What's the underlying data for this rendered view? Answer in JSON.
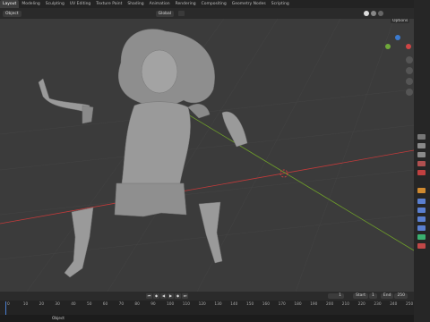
{
  "workspace_tabs": [
    "Layout",
    "Modeling",
    "Sculpting",
    "UV Editing",
    "Texture Paint",
    "Shading",
    "Animation",
    "Rendering",
    "Compositing",
    "Geometry Nodes",
    "Scripting"
  ],
  "header": {
    "object_mode": "Object",
    "transform": "Global",
    "options": "Options"
  },
  "timeline": {
    "current_frame": "1",
    "start_label": "Start",
    "start": "1",
    "end_label": "End",
    "end": "250",
    "ruler": [
      "0",
      "10",
      "20",
      "30",
      "40",
      "50",
      "60",
      "70",
      "80",
      "90",
      "100",
      "110",
      "120",
      "130",
      "140",
      "150",
      "160",
      "170",
      "180",
      "190",
      "200",
      "210",
      "220",
      "230",
      "240",
      "250"
    ]
  },
  "status": {
    "object_label": "Object"
  },
  "colors": {
    "x_axis": "#c33b3b",
    "y_axis": "#6e9e2a",
    "viewport": "#3b3b3b",
    "model": "#9a9a9a"
  }
}
